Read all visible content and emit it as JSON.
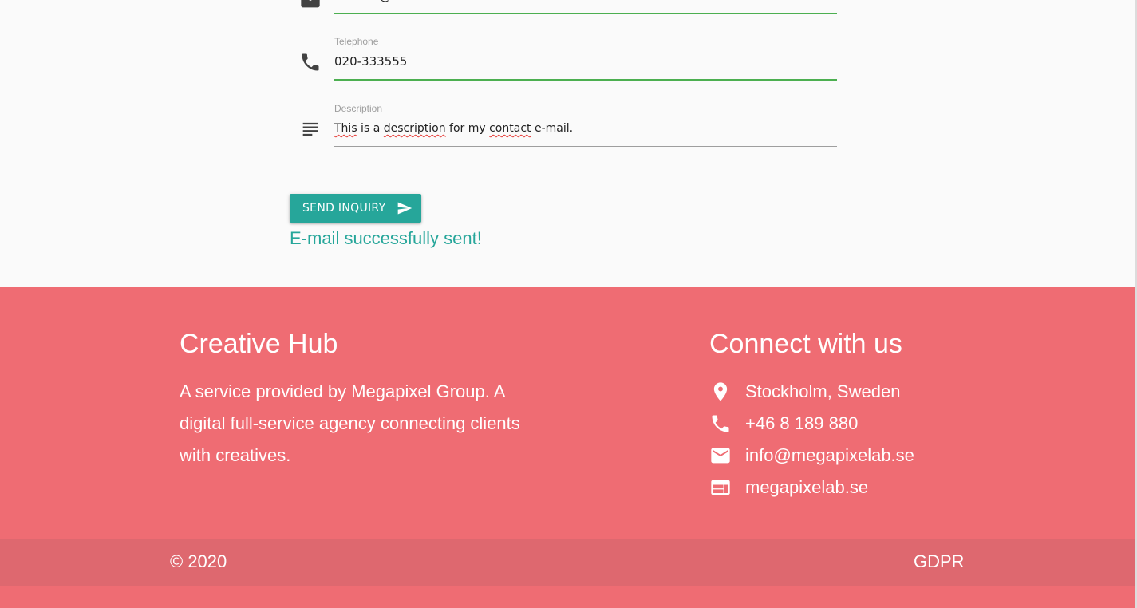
{
  "form": {
    "email": {
      "value": "contact@email.com"
    },
    "telephone": {
      "label": "Telephone",
      "value": "020-333555"
    },
    "description": {
      "label": "Description",
      "words": [
        "This",
        " is a ",
        "description",
        " for my ",
        "contact",
        " e-mail."
      ]
    },
    "send_button_label": "SEND INQUIRY",
    "success_message": "E-mail successfully sent!"
  },
  "footer": {
    "about": {
      "title": "Creative Hub",
      "text": "A service provided by Megapixel Group. A digital full-service agency connecting clients with creatives."
    },
    "connect": {
      "title": "Connect with us",
      "items": [
        {
          "icon": "location-pin-icon",
          "text": "Stockholm, Sweden"
        },
        {
          "icon": "phone-icon",
          "text": "+46 8 189 880"
        },
        {
          "icon": "email-icon",
          "text": "info@megapixelab.se"
        },
        {
          "icon": "web-icon",
          "text": "megapixelab.se"
        }
      ]
    },
    "copyright": "© 2020",
    "gdpr_link": "GDPR"
  },
  "colors": {
    "accent": "#26a69a",
    "footer_bg": "#ef6c73",
    "footer_bar_bg": "#de686f",
    "input_active_line": "#4caf50"
  }
}
